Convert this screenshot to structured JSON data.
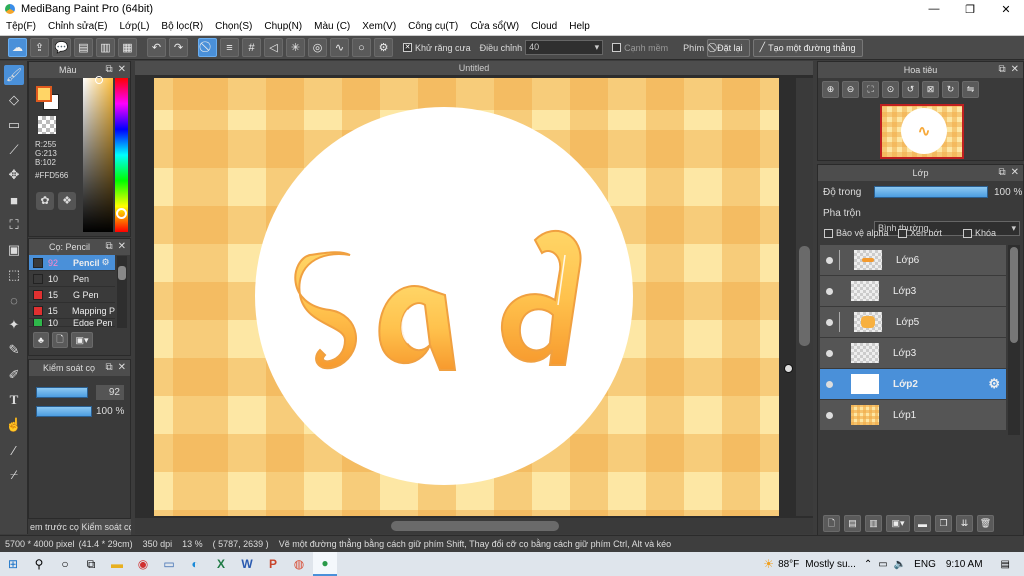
{
  "window": {
    "title": "MediBang Paint Pro (64bit)",
    "controls": [
      "—",
      "❐",
      "✕"
    ]
  },
  "menu": [
    "Tệp(F)",
    "Chỉnh sửa(E)",
    "Lớp(L)",
    "Bộ lọc(R)",
    "Chọn(S)",
    "Chụp(N)",
    "Màu (C)",
    "Xem(V)",
    "Công cụ(T)",
    "Cửa sổ(W)",
    "Cloud",
    "Help"
  ],
  "toolbar": {
    "antialias_label": "Khử răng cưa",
    "correction_label": "Điều chỉnh",
    "correction_value": "40",
    "soft_edge_label": "Cạnh mềm",
    "key_label": "Phím",
    "reset_label": "Đặt lại",
    "make_line_label": "Tạo một đường thẳng"
  },
  "color_panel": {
    "title": "Màu",
    "r": "R:255",
    "g": "G:213",
    "b": "B:102",
    "hex": "#FFD566",
    "fg_color": "#ffd566",
    "bg_color": "#ffffff"
  },
  "brush_panel": {
    "title": "Cọ: Pencil",
    "items": [
      {
        "size": "92",
        "name": "Pencil",
        "color": "#3a3a3a",
        "selected": true
      },
      {
        "size": "10",
        "name": "Pen",
        "color": "#3a3a3a"
      },
      {
        "size": "15",
        "name": "G Pen",
        "color": "#e03030"
      },
      {
        "size": "15",
        "name": "Mapping P",
        "color": "#e03030"
      },
      {
        "size": "10",
        "name": "Edge Pen",
        "color": "#2eb84a"
      }
    ]
  },
  "brush_control": {
    "title": "Kiểm soát cọ",
    "size_value": "92",
    "size_fill": 0.92,
    "opacity_value": "100 %",
    "opacity_fill": 1.0
  },
  "bottom_tabs": [
    "em trước cọ",
    "Kiểm soát cọ"
  ],
  "canvas": {
    "tab_title": "Untitled",
    "colors": {
      "bg": "#fde7a4",
      "stripe": "#f0aa46",
      "text_fill": "#f7a93a",
      "text_highlight": "#ffd566"
    }
  },
  "navigator": {
    "title": "Hoa tiêu"
  },
  "layer_panel": {
    "title": "Lớp",
    "opacity_label": "Độ trong",
    "opacity_value": "100 %",
    "blend_label": "Pha trộn",
    "blend_value": "Bình thường",
    "protect_alpha_label": "Bảo vệ alpha",
    "clip_label": "Xén bớt",
    "lock_label": "Khóa",
    "layers": [
      {
        "name": "Lớp6",
        "indent": true,
        "selected": false
      },
      {
        "name": "Lớp3",
        "indent": false,
        "selected": false
      },
      {
        "name": "Lớp5",
        "indent": true,
        "selected": false
      },
      {
        "name": "Lớp3",
        "indent": false,
        "selected": false
      },
      {
        "name": "Lớp2",
        "indent": false,
        "selected": true
      },
      {
        "name": "Lớp1",
        "indent": false,
        "selected": false
      }
    ]
  },
  "status": {
    "size": "5700 * 4000 pixel",
    "size_cm": "(41.4 * 29cm)",
    "dpi": "350 dpi",
    "zoom": "13 %",
    "coords": "( 5787, 2639 )",
    "hint": "Vẽ một đường thẳng bằng cách giữ phím Shift, Thay đổi cỡ cọ bằng cách giữ phím Ctrl, Alt và kéo"
  },
  "taskbar": {
    "weather": "88°F",
    "weather_desc": "Mostly su...",
    "lang": "ENG",
    "time": "9:10 AM"
  }
}
